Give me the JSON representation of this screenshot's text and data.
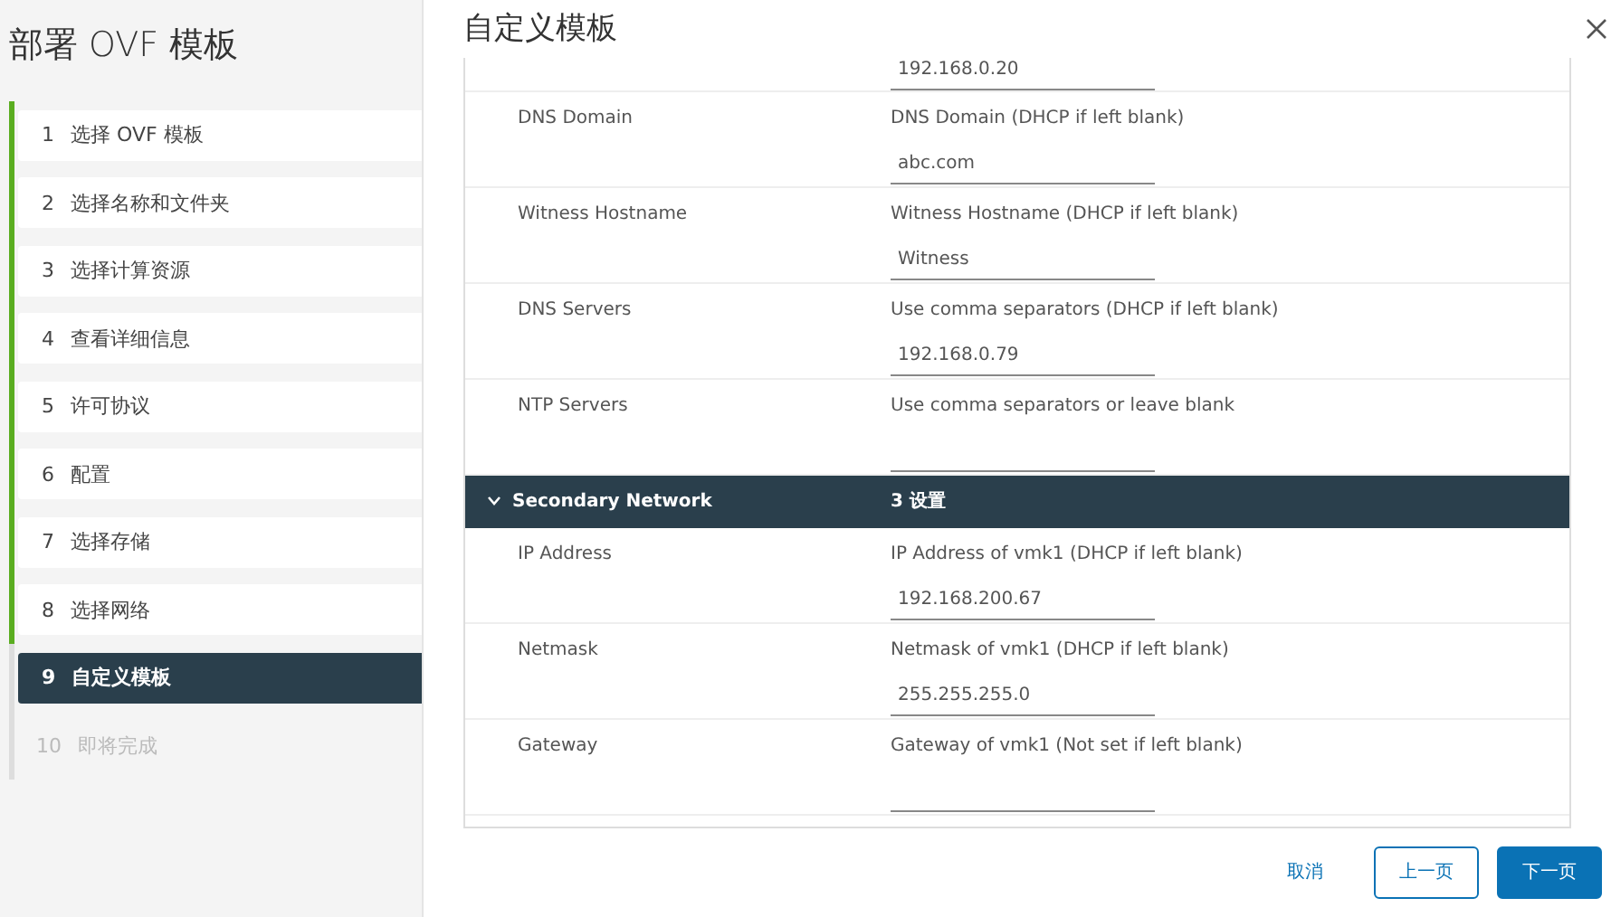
{
  "window": {
    "title": "部署 OVF 模板"
  },
  "steps": [
    {
      "number": "1",
      "label": "选择 OVF 模板",
      "completed": true,
      "selected": false,
      "disabled": false
    },
    {
      "number": "2",
      "label": "选择名称和文件夹",
      "completed": true,
      "selected": false,
      "disabled": false
    },
    {
      "number": "3",
      "label": "选择计算资源",
      "completed": true,
      "selected": false,
      "disabled": false
    },
    {
      "number": "4",
      "label": "查看详细信息",
      "completed": true,
      "selected": false,
      "disabled": false
    },
    {
      "number": "5",
      "label": "许可协议",
      "completed": true,
      "selected": false,
      "disabled": false
    },
    {
      "number": "6",
      "label": "配置",
      "completed": true,
      "selected": false,
      "disabled": false
    },
    {
      "number": "7",
      "label": "选择存储",
      "completed": true,
      "selected": false,
      "disabled": false
    },
    {
      "number": "8",
      "label": "选择网络",
      "completed": true,
      "selected": false,
      "disabled": false
    },
    {
      "number": "9",
      "label": "自定义模板",
      "completed": false,
      "selected": true,
      "disabled": false
    },
    {
      "number": "10",
      "label": "即将完成",
      "completed": false,
      "selected": false,
      "disabled": true
    }
  ],
  "page": {
    "title": "自定义模板"
  },
  "rows": [
    {
      "kind": "partial",
      "value": "192.168.0.20"
    },
    {
      "kind": "field",
      "label": "DNS Domain",
      "description": "DNS Domain (DHCP if left blank)",
      "value": "abc.com"
    },
    {
      "kind": "field",
      "label": "Witness Hostname",
      "description": "Witness Hostname (DHCP if left blank)",
      "value": "Witness"
    },
    {
      "kind": "field",
      "label": "DNS Servers",
      "description": "Use comma separators (DHCP if left blank)",
      "value": "192.168.0.79"
    },
    {
      "kind": "field",
      "label": "NTP Servers",
      "description": "Use comma separators or leave blank"
    },
    {
      "kind": "section",
      "label": "Secondary Network",
      "count": "3 设置",
      "expanded": true
    },
    {
      "kind": "field",
      "label": "IP Address",
      "description": "IP Address of vmk1 (DHCP if left blank)",
      "value": "192.168.200.67"
    },
    {
      "kind": "field",
      "label": "Netmask",
      "description": "Netmask of vmk1 (DHCP if left blank)",
      "value": "255.255.255.0"
    },
    {
      "kind": "field",
      "label": "Gateway",
      "description": "Gateway of vmk1 (Not set if left blank)"
    }
  ],
  "buttons": {
    "cancel": "取消",
    "back": "上一页",
    "next": "下一页"
  }
}
